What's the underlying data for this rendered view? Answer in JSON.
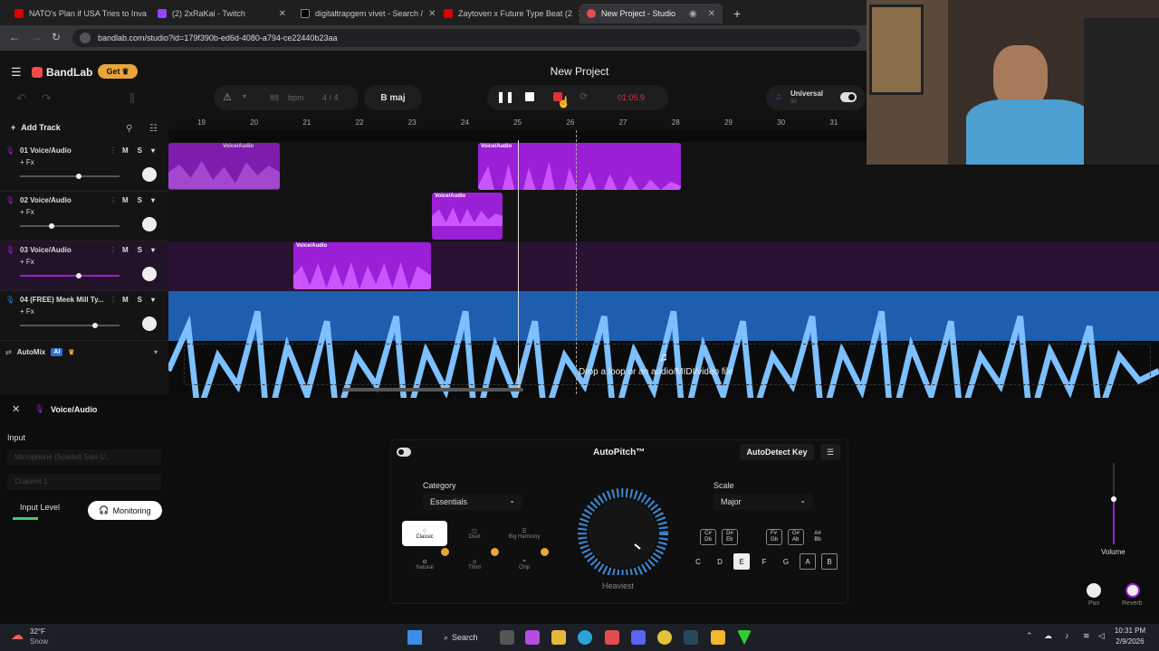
{
  "browser": {
    "tabs": [
      {
        "title": "NATO's Plan if USA Tries to Inva",
        "color": "#e00000"
      },
      {
        "title": "(2) 2xRaKai - Twitch",
        "color": "#9146ff"
      },
      {
        "title": "digitaltrapgem vivet - Search /",
        "color": "#000000"
      },
      {
        "title": "Zaytoven x Future Type Beat (2",
        "color": "#e00000"
      },
      {
        "title": "New Project - Studio",
        "color": "#f04a4a"
      }
    ],
    "url": "bandlab.com/studio?id=179f390b-ed6d-4080-a794-ce22440b23aa"
  },
  "header": {
    "brand": "BandLab",
    "get_label": "Get",
    "project_title": "New Project",
    "bpm_value": "88",
    "bpm_unit": "bpm",
    "time_sig": "4 / 4",
    "key": "B maj",
    "time": "01:05.9",
    "instrument_name": "Universal",
    "instrument_sub": "50"
  },
  "timeline": {
    "add_track": "Add Track",
    "ruler": [
      "19",
      "20",
      "21",
      "22",
      "23",
      "24",
      "25",
      "26",
      "27",
      "28",
      "29",
      "30",
      "31"
    ]
  },
  "tracks": [
    {
      "name": "01  Voice/Audio",
      "fx": "+ Fx",
      "mute": "M",
      "solo": "S"
    },
    {
      "name": "02  Voice/Audio",
      "fx": "+ Fx",
      "mute": "M",
      "solo": "S"
    },
    {
      "name": "03  Voice/Audio",
      "fx": "+ Fx",
      "mute": "M",
      "solo": "S"
    },
    {
      "name": "04  (FREE) Meek Mill Ty...",
      "fx": "+ Fx",
      "mute": "M",
      "solo": "S"
    }
  ],
  "clip_label": "Voice/Audio",
  "automix": {
    "label": "AutoMix",
    "badge": "AI"
  },
  "dropzone": "Drop a loop or an audio/MIDI/video file",
  "panel": {
    "title": "Voice/Audio",
    "input_label": "Input",
    "input_device": "Microphone (Scarlett Solo U...",
    "channel": "Channel 1",
    "input_level": "Input Level",
    "monitoring": "Monitoring",
    "volume": "Volume",
    "pan": "Pan",
    "reverb": "Reverb"
  },
  "autopitch": {
    "title": "AutoPitch™",
    "autodetect": "AutoDetect Key",
    "category_label": "Category",
    "category_value": "Essentials",
    "effects": [
      "Classic",
      "Duet",
      "Big Harmony",
      "Natural",
      "Third",
      "Chip"
    ],
    "knob_label": "Heaviest",
    "scale_label": "Scale",
    "scale_value": "Major",
    "sharps": [
      "C#\nDb",
      "D#\nEb",
      "F#\nGb",
      "G#\nAb",
      "A#\nBb"
    ],
    "keys": [
      "C",
      "D",
      "E",
      "F",
      "G",
      "A",
      "B"
    ]
  },
  "taskbar": {
    "weather_temp": "32°F",
    "weather_desc": "Snow",
    "search": "Search",
    "time": "10:31 PM",
    "date": "2/9/2026"
  },
  "colors": {
    "accent": "#9b1fd6",
    "blue_track": "#2f7fd8",
    "record": "#e0303a",
    "get": "#e8a53a"
  }
}
